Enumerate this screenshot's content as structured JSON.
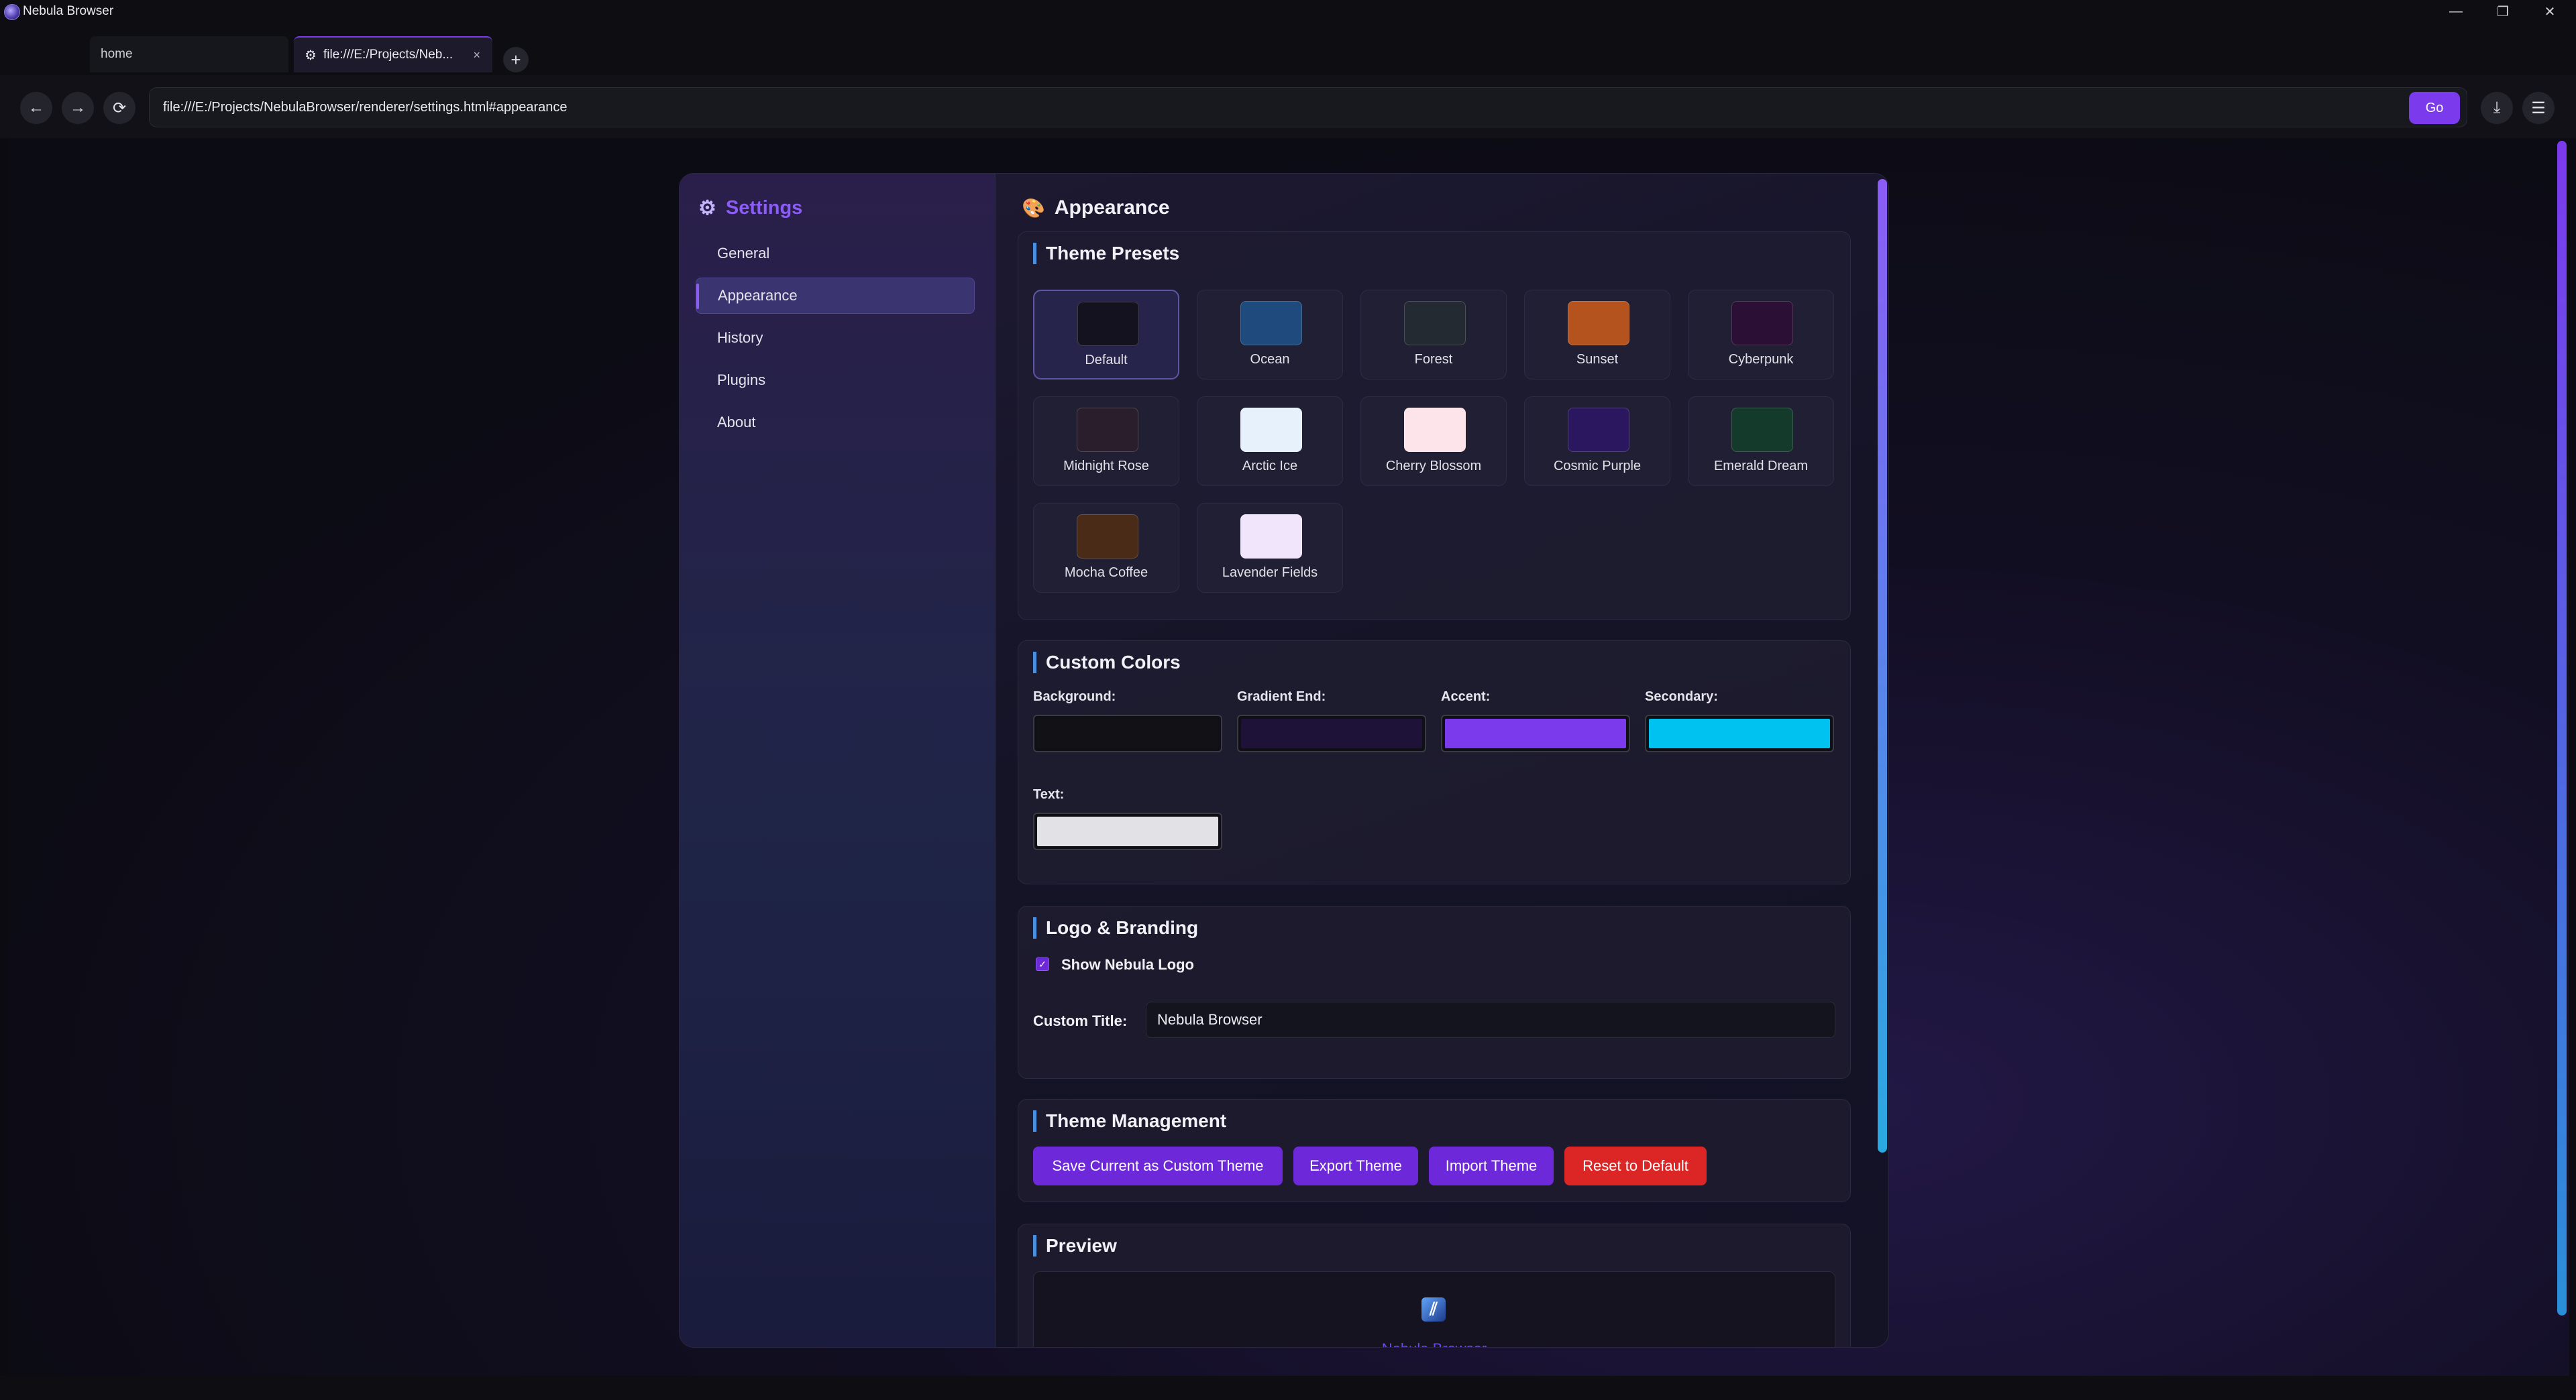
{
  "window": {
    "title": "Nebula Browser",
    "controls": {
      "minimize": "—",
      "restore": "❐",
      "close": "✕"
    }
  },
  "tabs": [
    {
      "label": "home",
      "active": false
    },
    {
      "label": "file:///E:/Projects/Neb...",
      "active": true,
      "icon": "gear-icon",
      "close": "×"
    }
  ],
  "new_tab": "+",
  "nav": {
    "back": "←",
    "forward": "→",
    "reload": "⟳",
    "url": "file:///E:/Projects/NebulaBrowser/renderer/settings.html#appearance",
    "go_label": "Go",
    "download_icon": "⤓",
    "menu_icon": "☰"
  },
  "settings": {
    "title": "Settings",
    "icon": "⚙",
    "nav_items": [
      {
        "label": "General",
        "active": false
      },
      {
        "label": "Appearance",
        "active": true
      },
      {
        "label": "History",
        "active": false
      },
      {
        "label": "Plugins",
        "active": false
      },
      {
        "label": "About",
        "active": false
      }
    ]
  },
  "appearance": {
    "title": "Appearance",
    "icon": "🎨",
    "theme_presets": {
      "title": "Theme Presets",
      "items": [
        {
          "name": "Default",
          "color": "#14121f",
          "active": true
        },
        {
          "name": "Ocean",
          "color": "#1f4a7d"
        },
        {
          "name": "Forest",
          "color": "#232a31"
        },
        {
          "name": "Sunset",
          "color": "#b4531e"
        },
        {
          "name": "Cyberpunk",
          "color": "#2b0f35"
        },
        {
          "name": "Midnight Rose",
          "color": "#2a1e2c"
        },
        {
          "name": "Arctic Ice",
          "color": "#e6f1fc"
        },
        {
          "name": "Cherry Blossom",
          "color": "#fde4ea"
        },
        {
          "name": "Cosmic Purple",
          "color": "#2b1660"
        },
        {
          "name": "Emerald Dream",
          "color": "#143a2b"
        },
        {
          "name": "Mocha Coffee",
          "color": "#4a2b18"
        },
        {
          "name": "Lavender Fields",
          "color": "#f1e5fc"
        }
      ]
    },
    "custom_colors": {
      "title": "Custom Colors",
      "fields": [
        {
          "label": "Background:",
          "color": "#111116"
        },
        {
          "label": "Gradient End:",
          "color": "#1f1238"
        },
        {
          "label": "Accent:",
          "color": "#7c3aed"
        },
        {
          "label": "Secondary:",
          "color": "#00c2f0"
        },
        {
          "label": "Text:",
          "color": "#e2e2e6"
        }
      ]
    },
    "logo_branding": {
      "title": "Logo & Branding",
      "show_logo_label": "Show Nebula Logo",
      "show_logo_checked": true,
      "check_mark": "✓",
      "custom_title_label": "Custom Title:",
      "custom_title_value": "Nebula Browser"
    },
    "theme_management": {
      "title": "Theme Management",
      "buttons": [
        {
          "label": "Save Current as Custom Theme",
          "color": "#6d28d9"
        },
        {
          "label": "Export Theme",
          "color": "#6d28d9"
        },
        {
          "label": "Import Theme",
          "color": "#6d28d9"
        },
        {
          "label": "Reset to Default",
          "color": "#dc2626"
        }
      ]
    },
    "preview": {
      "title": "Preview",
      "logo_glyph": "⫽",
      "app_title": "Nebula Browser"
    }
  }
}
